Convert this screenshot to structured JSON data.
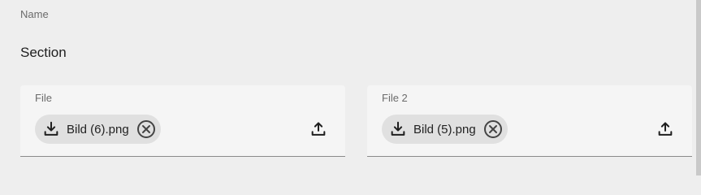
{
  "form": {
    "name_label": "Name",
    "section_title": "Section"
  },
  "fields": [
    {
      "label": "File",
      "file_name": "Bild (6).png",
      "icons": {
        "download": "download-icon",
        "remove": "close-circle-icon",
        "upload": "upload-icon"
      }
    },
    {
      "label": "File 2",
      "file_name": "Bild (5).png",
      "icons": {
        "download": "download-icon",
        "remove": "close-circle-icon",
        "upload": "upload-icon"
      }
    }
  ],
  "colors": {
    "background": "#eeeeee",
    "field_background": "#f5f5f5",
    "chip_background": "#e0e0e0",
    "underline": "#8a8a8a",
    "icon": "#1f1f1f"
  }
}
